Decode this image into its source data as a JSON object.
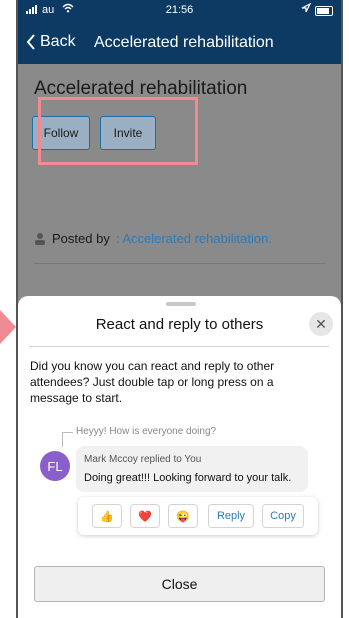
{
  "status": {
    "carrier": "au",
    "time": "21:56"
  },
  "nav": {
    "back_label": "Back",
    "title": "Accelerated rehabilitation"
  },
  "page": {
    "title": "Accelerated rehabilitation",
    "follow_label": "Follow",
    "invite_label": "Invite",
    "posted_by_label": "Posted by",
    "posted_by_value": ": Accelerated rehabilitation."
  },
  "sheet": {
    "title": "React and reply to others",
    "description": "Did you know you can react and reply to other attendees? Just double tap or long press on a message to start.",
    "quoted_text": "Heyyy! How is everyone doing?",
    "avatar_initials": "FL",
    "reply_name": "Mark Mccoy replied to You",
    "reply_message": "Doing great!!! Looking forward to your talk.",
    "reactions": [
      "👍",
      "❤️",
      "😜"
    ],
    "reply_label": "Reply",
    "copy_label": "Copy",
    "close_label": "Close"
  },
  "colors": {
    "nav_bg": "#0c3a63",
    "accent": "#2b7bb8",
    "highlight": "#f08a93",
    "avatar": "#8a5fc9"
  },
  "icons": [
    "chevron-left-icon",
    "person-icon",
    "close-icon",
    "signal-icon",
    "wifi-icon",
    "location-icon",
    "battery-icon"
  ]
}
